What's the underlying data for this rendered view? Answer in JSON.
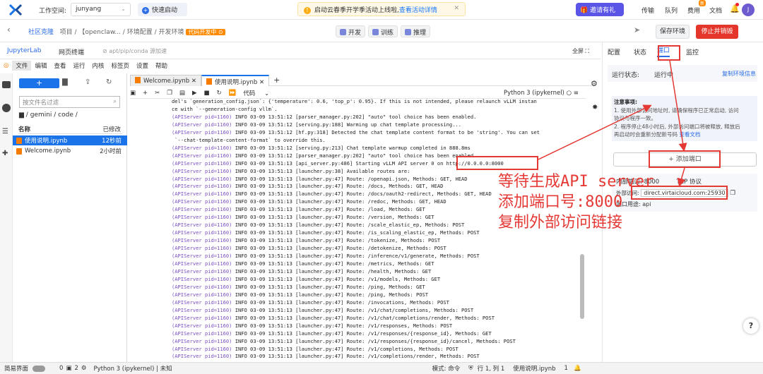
{
  "topbar": {
    "workspace_label": "工作空间:",
    "workspace_value": "junyang",
    "quick_start": "快速启动",
    "notice_text": "启动云春季开学季活动上线啦,",
    "notice_link": "查看活动详情",
    "invite": "邀请有礼",
    "links": [
      "传输",
      "队列",
      "费用",
      "文档"
    ],
    "new_badge": "新",
    "avatar_initial": "J"
  },
  "bar2": {
    "breadcrumb": [
      "社区克隆",
      "项目",
      "【openclaw...",
      "环境配置",
      "开发环境"
    ],
    "dev_tag": "代码开发中 ⊙",
    "modes": [
      "开发",
      "训练",
      "推理"
    ],
    "save_env": "保存环境",
    "stop_env": "停止并销毁"
  },
  "jupyter": {
    "tabs": [
      "JupyterLab",
      "网页终端"
    ],
    "pip_hint": "apt/pip/conda 源加速",
    "fullscreen": "全屏 ⛶",
    "menu": [
      "文件",
      "编辑",
      "查看",
      "运行",
      "内核",
      "标签页",
      "设置",
      "帮助"
    ]
  },
  "filebrowser": {
    "filter_placeholder": "按文件名过滤",
    "path": "/ gemini / code /",
    "col_name": "名称",
    "col_modified": "已修改",
    "files": [
      {
        "name": "使用说明.ipynb",
        "time": "12秒前"
      },
      {
        "name": "Welcome.ipynb",
        "time": "2小时前"
      }
    ]
  },
  "editor": {
    "tabs": [
      "Welcome.ipynb",
      "使用说明.ipynb"
    ],
    "cell_type": "代码",
    "kernel": "Python 3 (ipykernel)"
  },
  "log_lines": [
    [
      "",
      "del's `generation_config.json`: {'temperature': 0.6, 'top_p': 0.95}. If this is not intended, please relaunch vLLM instan"
    ],
    [
      "",
      "ce with `--generation-config vllm`."
    ],
    [
      "(APIServer pid=1160)",
      " INFO 03-09 13:51:12 [parser_manager.py:202] \"auto\" tool choice has been enabled."
    ],
    [
      "(APIServer pid=1160)",
      " INFO 03-09 13:51:12 [serving.py:188] Warming up chat template processing..."
    ],
    [
      "(APIServer pid=1160)",
      " INFO 03-09 13:51:12 [hf.py:318] Detected the chat template content format to be 'string'. You can set"
    ],
    [
      "",
      " `--chat-template-content-format` to override this."
    ],
    [
      "(APIServer pid=1160)",
      " INFO 03-09 13:51:12 [serving.py:213] Chat template warmup completed in 888.8ms"
    ],
    [
      "(APIServer pid=1160)",
      " INFO 03-09 13:51:12 [parser_manager.py:202] \"auto\" tool choice has been enabled."
    ],
    [
      "(APIServer pid=1160)",
      " INFO 03-09 13:51:13 [api_server.py:486] Starting vLLM API server 0 on http://0.0.0.0:8000"
    ],
    [
      "(APIServer pid=1160)",
      " INFO 03-09 13:51:13 [launcher.py:38] Available routes are:"
    ],
    [
      "(APIServer pid=1160)",
      " INFO 03-09 13:51:13 [launcher.py:47] Route: /openapi.json, Methods: GET, HEAD"
    ],
    [
      "(APIServer pid=1160)",
      " INFO 03-09 13:51:13 [launcher.py:47] Route: /docs, Methods: GET, HEAD"
    ],
    [
      "(APIServer pid=1160)",
      " INFO 03-09 13:51:13 [launcher.py:47] Route: /docs/oauth2-redirect, Methods: GET, HEAD"
    ],
    [
      "(APIServer pid=1160)",
      " INFO 03-09 13:51:13 [launcher.py:47] Route: /redoc, Methods: GET, HEAD"
    ],
    [
      "(APIServer pid=1160)",
      " INFO 03-09 13:51:13 [launcher.py:47] Route: /load, Methods: GET"
    ],
    [
      "(APIServer pid=1160)",
      " INFO 03-09 13:51:13 [launcher.py:47] Route: /version, Methods: GET"
    ],
    [
      "(APIServer pid=1160)",
      " INFO 03-09 13:51:13 [launcher.py:47] Route: /scale_elastic_ep, Methods: POST"
    ],
    [
      "(APIServer pid=1160)",
      " INFO 03-09 13:51:13 [launcher.py:47] Route: /is_scaling_elastic_ep, Methods: POST"
    ],
    [
      "(APIServer pid=1160)",
      " INFO 03-09 13:51:13 [launcher.py:47] Route: /tokenize, Methods: POST"
    ],
    [
      "(APIServer pid=1160)",
      " INFO 03-09 13:51:13 [launcher.py:47] Route: /detokenize, Methods: POST"
    ],
    [
      "(APIServer pid=1160)",
      " INFO 03-09 13:51:13 [launcher.py:47] Route: /inference/v1/generate, Methods: POST"
    ],
    [
      "(APIServer pid=1160)",
      " INFO 03-09 13:51:13 [launcher.py:47] Route: /metrics, Methods: GET"
    ],
    [
      "(APIServer pid=1160)",
      " INFO 03-09 13:51:13 [launcher.py:47] Route: /health, Methods: GET"
    ],
    [
      "(APIServer pid=1160)",
      " INFO 03-09 13:51:13 [launcher.py:47] Route: /v1/models, Methods: GET"
    ],
    [
      "(APIServer pid=1160)",
      " INFO 03-09 13:51:13 [launcher.py:47] Route: /ping, Methods: GET"
    ],
    [
      "(APIServer pid=1160)",
      " INFO 03-09 13:51:13 [launcher.py:47] Route: /ping, Methods: POST"
    ],
    [
      "(APIServer pid=1160)",
      " INFO 03-09 13:51:13 [launcher.py:47] Route: /invocations, Methods: POST"
    ],
    [
      "(APIServer pid=1160)",
      " INFO 03-09 13:51:13 [launcher.py:47] Route: /v1/chat/completions, Methods: POST"
    ],
    [
      "(APIServer pid=1160)",
      " INFO 03-09 13:51:13 [launcher.py:47] Route: /v1/chat/completions/render, Methods: POST"
    ],
    [
      "(APIServer pid=1160)",
      " INFO 03-09 13:51:13 [launcher.py:47] Route: /v1/responses, Methods: POST"
    ],
    [
      "(APIServer pid=1160)",
      " INFO 03-09 13:51:13 [launcher.py:47] Route: /v1/responses/{response_id}, Methods: GET"
    ],
    [
      "(APIServer pid=1160)",
      " INFO 03-09 13:51:13 [launcher.py:47] Route: /v1/responses/{response_id}/cancel, Methods: POST"
    ],
    [
      "(APIServer pid=1160)",
      " INFO 03-09 13:51:13 [launcher.py:47] Route: /v1/completions, Methods: POST"
    ],
    [
      "(APIServer pid=1160)",
      " INFO 03-09 13:51:13 [launcher.py:47] Route: /v1/completions/render, Methods: POST"
    ]
  ],
  "right_panel": {
    "tabs": [
      "配置",
      "状态",
      "端口",
      "监控"
    ],
    "run_status_label": "运行状态:",
    "run_status": "运行中",
    "copy_env": "复制环境信息",
    "tips_title": "注意事项:",
    "tips": [
      "1. 使用外部访问地址时, 请确保程序已正常启动, 访问",
      "协议与程序一致。",
      "2. 程序停止48小时后, 外部访问端口将被释放, 释放后",
      "再启动时会重新分配新号码"
    ],
    "tips_link": "查看文档",
    "add_port": "+ 添加端口",
    "internal_port_label": "内部端口:",
    "internal_port": "8000",
    "protocol": "TCP 协议",
    "external_label": "外部访问:",
    "external_url": "direct.virtaicloud.com:25930",
    "usage_label": "端口用途:",
    "usage": "api"
  },
  "annotations": [
    "等待生成API server",
    "添加端口号:8000",
    "复制外部访问链接"
  ],
  "annotation_color": "#e53935",
  "accent": "#1a73e8",
  "statusbar": {
    "simple": "简易界面",
    "counts": [
      "0",
      "2"
    ],
    "kernel": "Python 3 (ipykernel) | 未知",
    "mode": "模式: 命令",
    "pos": "行 1, 列 1",
    "file": "使用说明.ipynb",
    "num": "1"
  },
  "help": "?"
}
